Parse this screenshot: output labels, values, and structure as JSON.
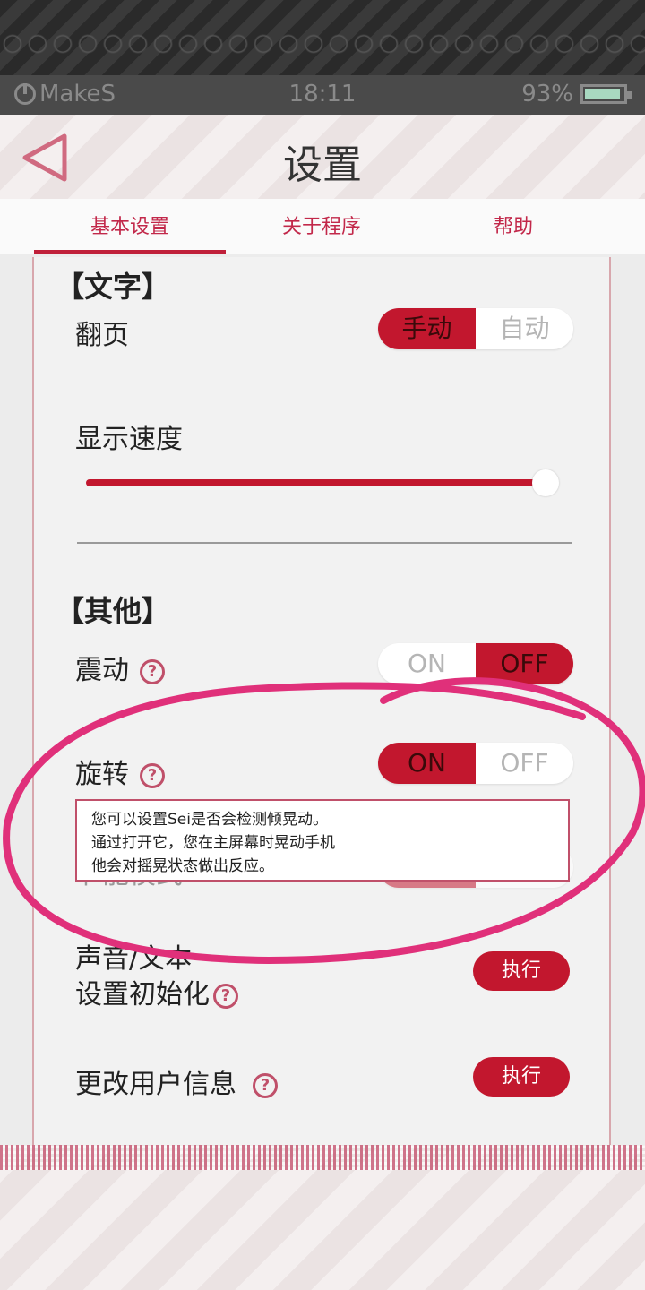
{
  "status_bar": {
    "brand": "MakeS",
    "time": "18:11",
    "battery": "93%",
    "battery_level": 0.93
  },
  "header": {
    "title": "设置"
  },
  "tabs": [
    {
      "label": "基本设置",
      "active": true
    },
    {
      "label": "关于程序",
      "active": false
    },
    {
      "label": "帮助",
      "active": false
    }
  ],
  "sections": {
    "text": {
      "title": "【文字】",
      "page_turn": {
        "label": "翻页",
        "options": [
          "手动",
          "自动"
        ],
        "selected": "手动"
      },
      "display_speed": {
        "label": "显示速度",
        "level": 1.0
      }
    },
    "other": {
      "title": "【其他】",
      "vibration": {
        "label": "震动",
        "options": [
          "ON",
          "OFF"
        ],
        "selected": "OFF"
      },
      "rotation": {
        "label": "旋转",
        "options": [
          "ON",
          "OFF"
        ],
        "selected": "ON"
      },
      "saving_mode": {
        "label": "节能模式",
        "options": [
          "ON",
          "OFF"
        ],
        "selected": "ON"
      },
      "reset": {
        "label_line1": "声音/文本",
        "label_line2": "设置初始化",
        "button": "执行"
      },
      "user_info": {
        "label": "更改用户信息",
        "button": "执行"
      }
    }
  },
  "tooltip": {
    "lines": [
      "您可以设置Sei是否会检测倾晃动。",
      "通过打开它，您在主屏幕时晃动手机",
      "他会对摇晃状态做出反应。"
    ]
  },
  "colors": {
    "accent": "#c2172e",
    "tab_text": "#c2284a",
    "annotation": "#e0307a"
  }
}
